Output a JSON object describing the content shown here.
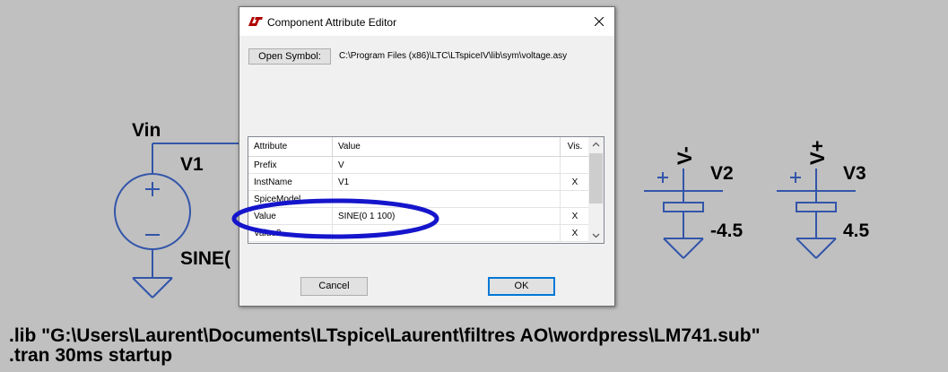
{
  "schematic": {
    "net_label": "Vin",
    "v1_name": "V1",
    "v1_value": "SINE(",
    "v2_name": "V2",
    "v2_value": "-4.5",
    "v3_name": "V3",
    "v3_value": "4.5",
    "vminus_label": "V-",
    "vplus_label": "V+",
    "directive_lib": ".lib \"G:\\Users\\Laurent\\Documents\\LTspice\\Laurent\\filtres AO\\wordpress\\LM741.sub\"",
    "directive_tran": ".tran 30ms startup"
  },
  "dialog": {
    "title": "Component Attribute Editor",
    "open_symbol_label": "Open Symbol:",
    "symbol_path": "C:\\Program Files (x86)\\LTC\\LTspiceIV\\lib\\sym\\voltage.asy",
    "grid": {
      "headers": {
        "attribute": "Attribute",
        "value": "Value",
        "vis": "Vis."
      },
      "rows": [
        {
          "attribute": "Prefix",
          "value": "V",
          "vis": ""
        },
        {
          "attribute": "InstName",
          "value": "V1",
          "vis": "X"
        },
        {
          "attribute": "SpiceModel",
          "value": "",
          "vis": ""
        },
        {
          "attribute": "Value",
          "value": "SINE(0 1 100)",
          "vis": "X"
        },
        {
          "attribute": "Value2",
          "value": "",
          "vis": "X"
        }
      ]
    },
    "cancel_label": "Cancel",
    "ok_label": "OK"
  },
  "colors": {
    "schematic_bg": "#c0c0c0",
    "wire": "#3355aa",
    "highlight": "#1515cc"
  }
}
